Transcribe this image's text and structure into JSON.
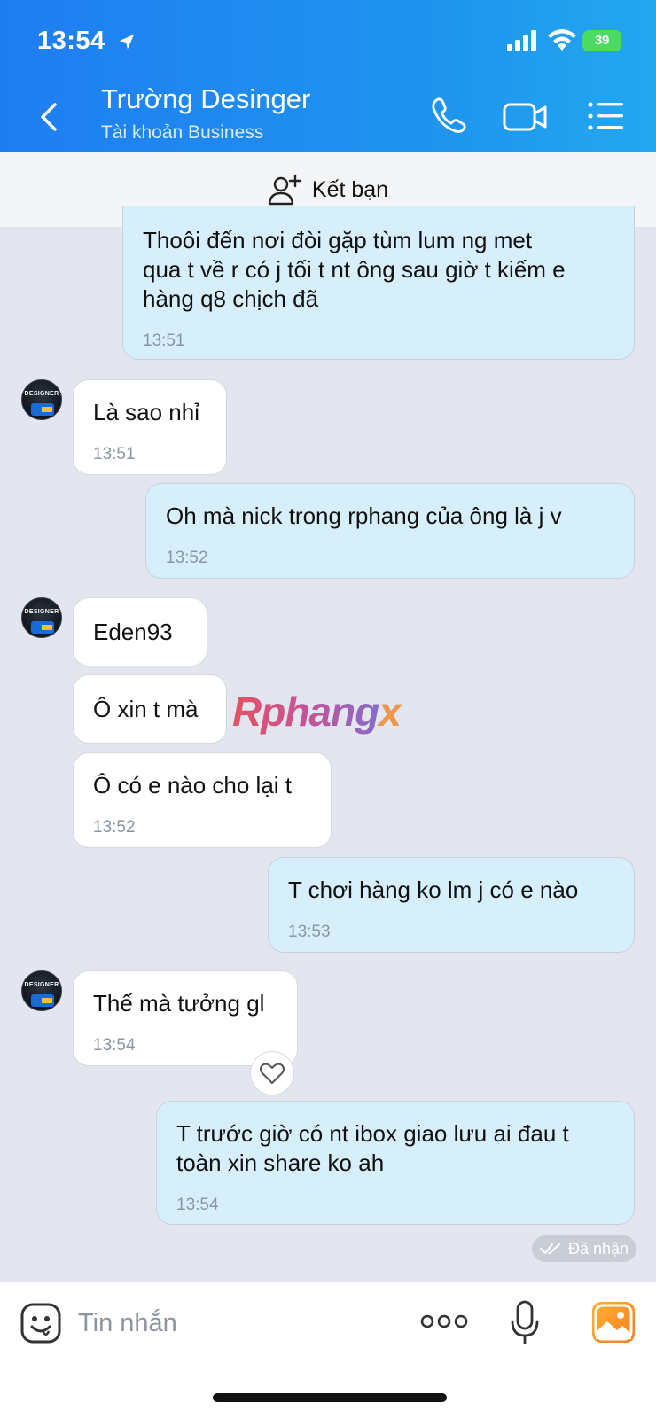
{
  "status_bar": {
    "time": "13:54",
    "battery": "39"
  },
  "header": {
    "contact_name": "Trường Desinger",
    "contact_subtitle": "Tài khoản Business"
  },
  "friend_bar": {
    "label": "Kết bạn"
  },
  "avatar": {
    "line1": "DESIGNER"
  },
  "messages": [
    {
      "side": "me",
      "text_lines": [
        "Thoôi đến nơi đòi gặp tùm lum ng met",
        "qua t về r có j tối t nt ông sau giờ t kiếm e",
        "hàng q8 chịch đã"
      ],
      "time": "13:51"
    },
    {
      "side": "them",
      "text_lines": [
        "Là sao nhỉ"
      ],
      "time": "13:51"
    },
    {
      "side": "me",
      "text_lines": [
        "Oh mà nick trong rphang của ông là j v"
      ],
      "time": "13:52"
    },
    {
      "side": "them",
      "text_lines": [
        "Eden93"
      ],
      "time": ""
    },
    {
      "side": "them",
      "text_lines": [
        "Ô xin t mà"
      ],
      "time": ""
    },
    {
      "side": "them",
      "text_lines": [
        "Ô có e nào cho lại t"
      ],
      "time": "13:52"
    },
    {
      "side": "me",
      "text_lines": [
        "T chơi hàng ko lm j có e nào"
      ],
      "time": "13:53"
    },
    {
      "side": "them",
      "text_lines": [
        "Thế mà tưởng gl"
      ],
      "time": "13:54"
    },
    {
      "side": "me",
      "text_lines": [
        "T trước giờ có nt ibox giao lưu ai đau t",
        "toàn xin share ko ah"
      ],
      "time": "13:54"
    }
  ],
  "received_label": "Đã nhận",
  "watermark": {
    "main": "Rphang",
    "accent": "x"
  },
  "input_bar": {
    "placeholder": "Tin nhắn"
  },
  "colors": {
    "header": "#1f7df2",
    "bubble_me": "#d7eefb",
    "bubble_them": "#ffffff",
    "background": "#e3e6ee"
  }
}
